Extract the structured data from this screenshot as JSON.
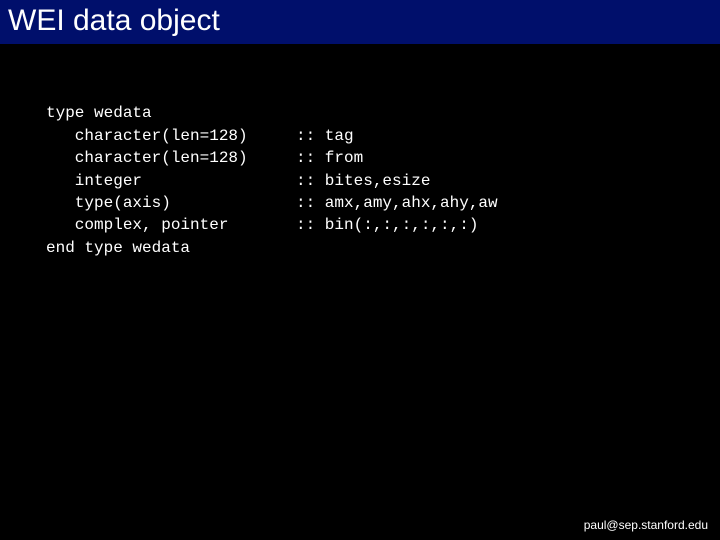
{
  "title": "WEI data object",
  "code": {
    "l0": "type wedata",
    "l1a": "   character(len=128)",
    "l1b": ":: tag",
    "l2a": "   character(len=128)",
    "l2b": ":: from",
    "l3a": "   integer",
    "l3b": ":: bites,esize",
    "l4a": "   type(axis)",
    "l4b": ":: amx,amy,ahx,ahy,aw",
    "l5a": "   complex, pointer",
    "l5b": ":: bin(:,:,:,:,:,:)",
    "l6": "end type wedata"
  },
  "footer": "paul@sep.stanford.edu"
}
